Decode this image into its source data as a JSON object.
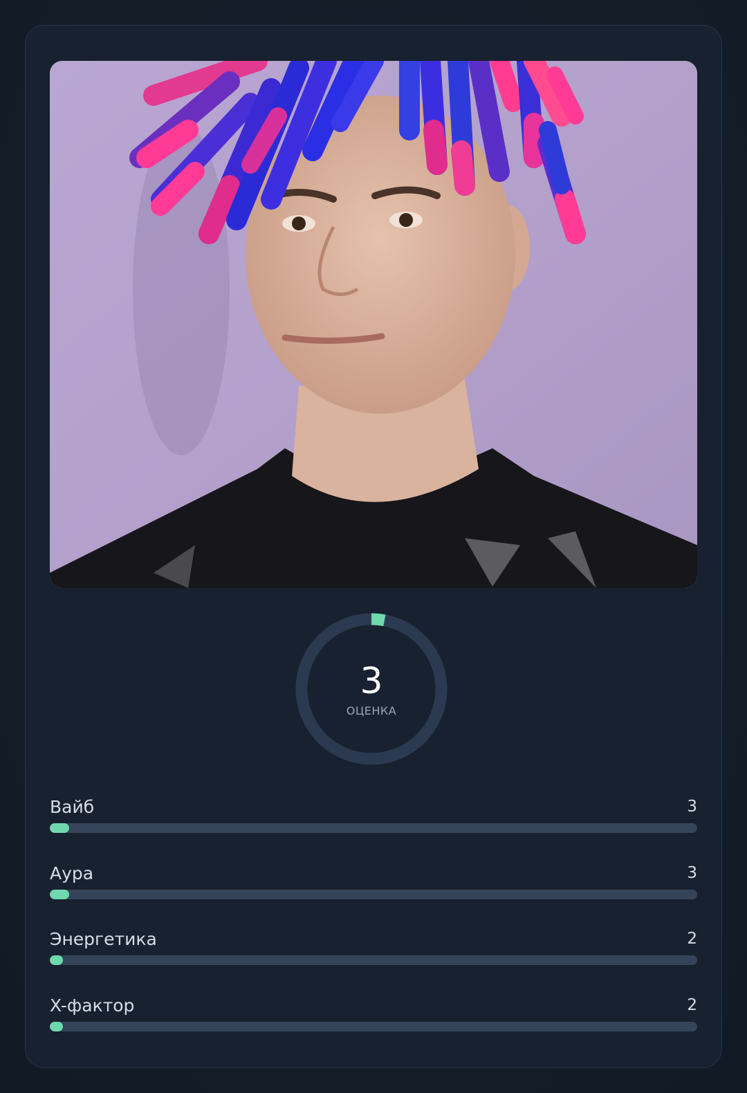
{
  "score": {
    "value": "3",
    "caption": "ОЦЕНКА",
    "max": 100
  },
  "metrics": [
    {
      "label": "Вайб",
      "value": "3",
      "level": 0.03
    },
    {
      "label": "Аура",
      "value": "3",
      "level": 0.03
    },
    {
      "label": "Энергетика",
      "value": "2",
      "level": 0.02
    },
    {
      "label": "X-фактор",
      "value": "2",
      "level": 0.02
    }
  ],
  "colors": {
    "accent": "#6fd8ad",
    "track": "#354459",
    "card": "#18212f",
    "ring": "#2b3a50"
  }
}
